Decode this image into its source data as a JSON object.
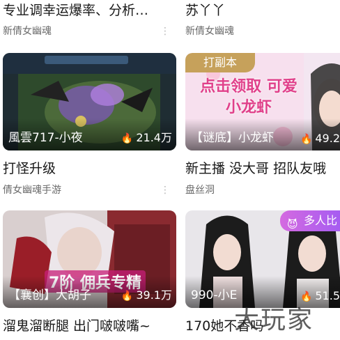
{
  "row1": {
    "left": {
      "title": "专业调幸运爆率、分析…",
      "channel": "新倩女幽魂",
      "more": "⋮"
    },
    "right": {
      "title": "苏丫丫",
      "channel": "新倩女幽魂",
      "more": "⋮"
    }
  },
  "row2": {
    "left": {
      "streamer": "風雲717-小夜",
      "views": "21.4万",
      "title": "打怪升级",
      "channel": "倩女幽魂手游",
      "more": "⋮"
    },
    "right": {
      "badge": "打副本",
      "overlay_text": "点击领取 可爱小龙虾",
      "streamer": "【谜底】小龙虾",
      "views": "49.2",
      "title": "新主播 没大哥 招队友哦",
      "channel": "盘丝洞"
    }
  },
  "row3": {
    "left": {
      "overlay_text": "7阶 佣兵专精",
      "streamer": "【襄创】大胡子",
      "views": "39.1万",
      "title": "溜鬼溜断腿 出门啵啵嘴~"
    },
    "right": {
      "multi": "多人比",
      "streamer": "990-小E",
      "views": "51.5",
      "title": "170她不香吗"
    }
  },
  "icons": {
    "flame": "flame-icon",
    "more": "more-vertical-icon",
    "mask": "mask-icon"
  },
  "watermark": "大玩家",
  "colors": {
    "badge": "#c6a15b",
    "multi_badge": "#b45ee8"
  }
}
